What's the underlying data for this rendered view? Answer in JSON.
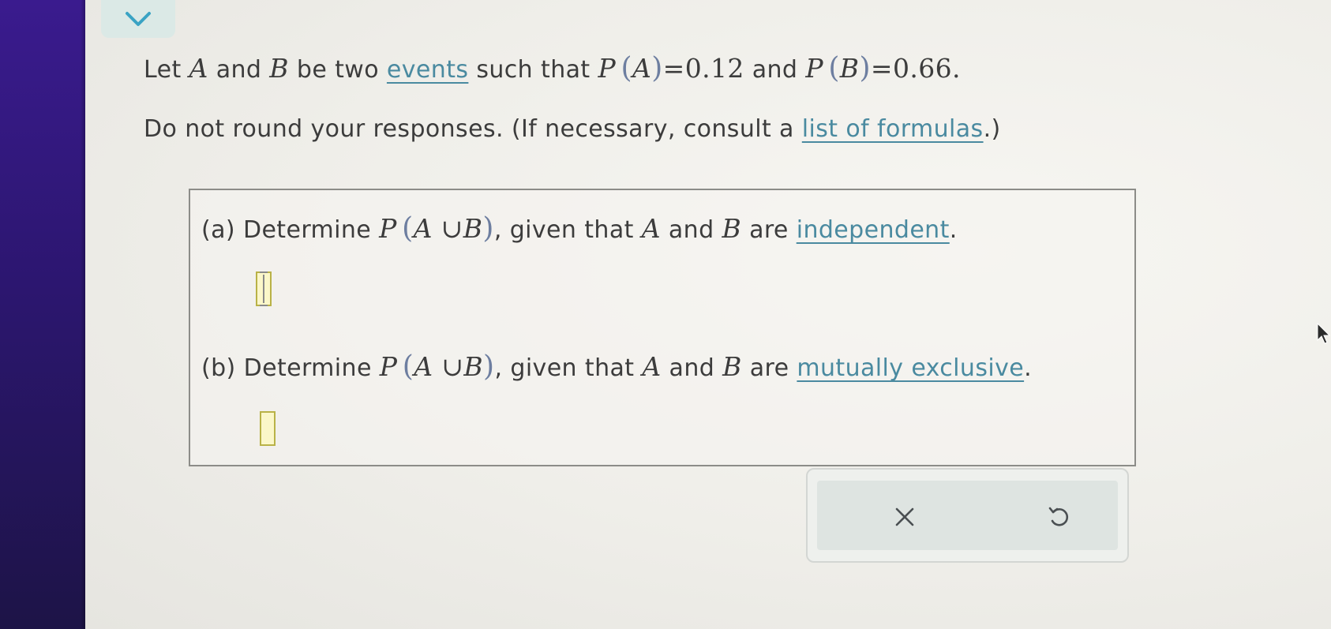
{
  "header": {
    "collapse_icon": "chevron-down-icon"
  },
  "intro": {
    "let": "Let",
    "A": "A",
    "and": "and",
    "B": "B",
    "be_two": "be two",
    "events_link": "events",
    "such_that": "such that",
    "P": "P",
    "lparen": "(",
    "rparen": ")",
    "eq_a": "=0.12",
    "eq_b": "=0.66.",
    "line2_prefix": "Do not round your responses. (If necessary, consult a",
    "formulas_link": "list of formulas",
    "line2_suffix": ".)"
  },
  "parts": [
    {
      "label": "(a)",
      "determine": "Determine",
      "union": "A ∪B",
      "given": ", given that",
      "are": "are",
      "condition_link": "independent",
      "period": ".",
      "answer_value": ""
    },
    {
      "label": "(b)",
      "determine": "Determine",
      "union": "A ∪B",
      "given": ", given that",
      "are": "are",
      "condition_link": "mutually exclusive",
      "period": ".",
      "answer_value": ""
    }
  ],
  "actions": {
    "clear_icon": "close-icon",
    "undo_icon": "undo-icon"
  },
  "colors": {
    "link": "#4a8aa0",
    "sidebar": "#3a1b8e",
    "answer_fill": "#fbf7c9",
    "answer_border": "#b9b247"
  }
}
